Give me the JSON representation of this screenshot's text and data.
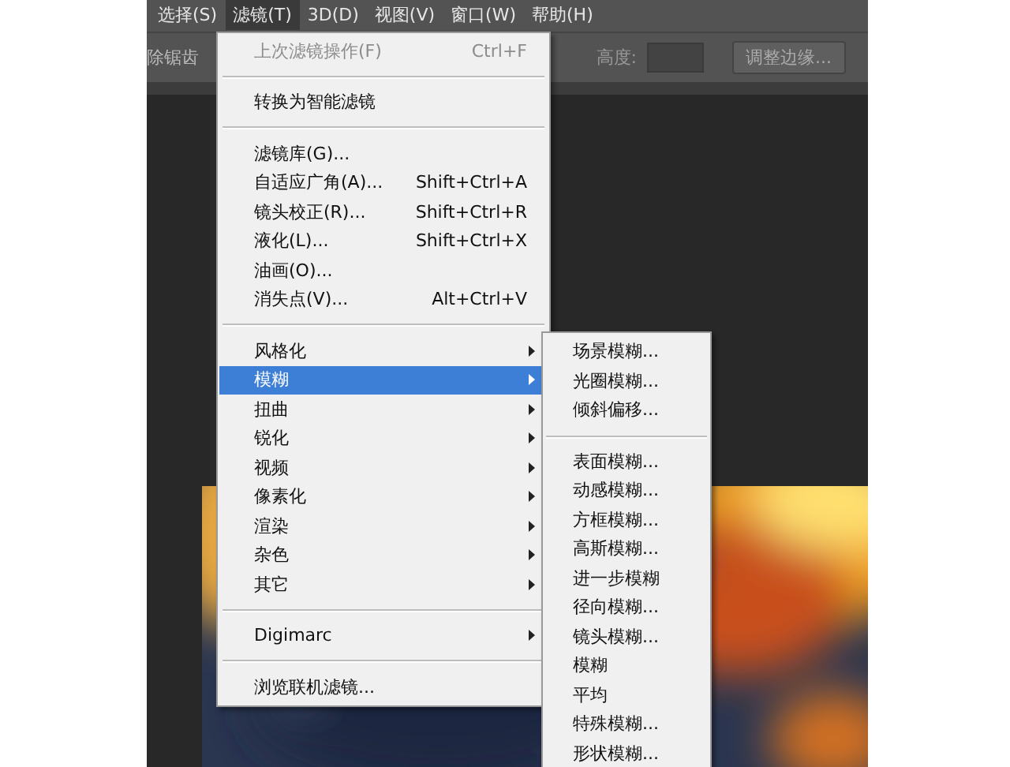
{
  "menubar": [
    {
      "label": "选择(S)",
      "selected": false
    },
    {
      "label": "滤镜(T)",
      "selected": true
    },
    {
      "label": "3D(D)",
      "selected": false
    },
    {
      "label": "视图(V)",
      "selected": false
    },
    {
      "label": "窗口(W)",
      "selected": false
    },
    {
      "label": "帮助(H)",
      "selected": false
    }
  ],
  "options_bar": {
    "antialias_label": "除锯齿",
    "height_label": "高度:",
    "refine_edge_button": "调整边缘..."
  },
  "filter_menu": [
    {
      "kind": "item",
      "label": "上次滤镜操作(F)",
      "shortcut": "Ctrl+F",
      "disabled": true,
      "submenu": false,
      "selected": false
    },
    {
      "kind": "separator"
    },
    {
      "kind": "item",
      "label": "转换为智能滤镜",
      "disabled": false,
      "submenu": false,
      "selected": false
    },
    {
      "kind": "separator"
    },
    {
      "kind": "item",
      "label": "滤镜库(G)...",
      "disabled": false,
      "submenu": false,
      "selected": false
    },
    {
      "kind": "item",
      "label": "自适应广角(A)...",
      "shortcut": "Shift+Ctrl+A",
      "disabled": false,
      "submenu": false,
      "selected": false
    },
    {
      "kind": "item",
      "label": "镜头校正(R)...",
      "shortcut": "Shift+Ctrl+R",
      "disabled": false,
      "submenu": false,
      "selected": false
    },
    {
      "kind": "item",
      "label": "液化(L)...",
      "shortcut": "Shift+Ctrl+X",
      "disabled": false,
      "submenu": false,
      "selected": false
    },
    {
      "kind": "item",
      "label": "油画(O)...",
      "disabled": false,
      "submenu": false,
      "selected": false
    },
    {
      "kind": "item",
      "label": "消失点(V)...",
      "shortcut": "Alt+Ctrl+V",
      "disabled": false,
      "submenu": false,
      "selected": false
    },
    {
      "kind": "separator"
    },
    {
      "kind": "item",
      "label": "风格化",
      "disabled": false,
      "submenu": true,
      "selected": false
    },
    {
      "kind": "item",
      "label": "模糊",
      "disabled": false,
      "submenu": true,
      "selected": true
    },
    {
      "kind": "item",
      "label": "扭曲",
      "disabled": false,
      "submenu": true,
      "selected": false
    },
    {
      "kind": "item",
      "label": "锐化",
      "disabled": false,
      "submenu": true,
      "selected": false
    },
    {
      "kind": "item",
      "label": "视频",
      "disabled": false,
      "submenu": true,
      "selected": false
    },
    {
      "kind": "item",
      "label": "像素化",
      "disabled": false,
      "submenu": true,
      "selected": false
    },
    {
      "kind": "item",
      "label": "渲染",
      "disabled": false,
      "submenu": true,
      "selected": false
    },
    {
      "kind": "item",
      "label": "杂色",
      "disabled": false,
      "submenu": true,
      "selected": false
    },
    {
      "kind": "item",
      "label": "其它",
      "disabled": false,
      "submenu": true,
      "selected": false
    },
    {
      "kind": "separator"
    },
    {
      "kind": "item",
      "label": "Digimarc",
      "disabled": false,
      "submenu": true,
      "selected": false
    },
    {
      "kind": "separator"
    },
    {
      "kind": "item",
      "label": "浏览联机滤镜...",
      "disabled": false,
      "submenu": false,
      "selected": false
    }
  ],
  "blur_submenu": [
    {
      "kind": "item",
      "label": "场景模糊..."
    },
    {
      "kind": "item",
      "label": "光圈模糊..."
    },
    {
      "kind": "item",
      "label": "倾斜偏移..."
    },
    {
      "kind": "separator"
    },
    {
      "kind": "item",
      "label": "表面模糊..."
    },
    {
      "kind": "item",
      "label": "动感模糊..."
    },
    {
      "kind": "item",
      "label": "方框模糊..."
    },
    {
      "kind": "item",
      "label": "高斯模糊..."
    },
    {
      "kind": "item",
      "label": "进一步模糊"
    },
    {
      "kind": "item",
      "label": "径向模糊..."
    },
    {
      "kind": "item",
      "label": "镜头模糊..."
    },
    {
      "kind": "item",
      "label": "模糊"
    },
    {
      "kind": "item",
      "label": "平均"
    },
    {
      "kind": "item",
      "label": "特殊模糊..."
    },
    {
      "kind": "item",
      "label": "形状模糊..."
    }
  ]
}
